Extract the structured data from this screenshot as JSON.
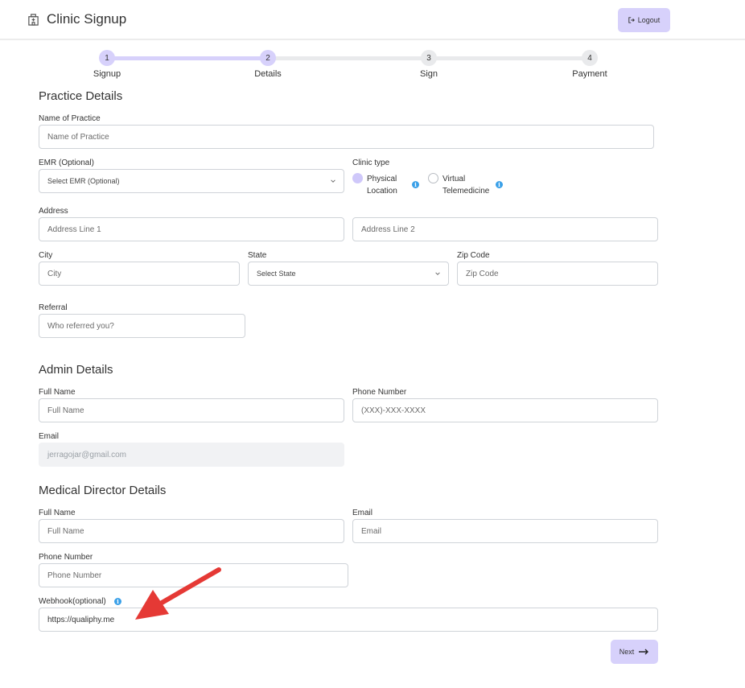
{
  "header": {
    "title": "Clinic Signup",
    "logout_label": "Logout",
    "logout_icon": "logout-icon",
    "brand_icon": "hospital-icon"
  },
  "stepper": {
    "current": 2,
    "steps": [
      {
        "number": "1",
        "label": "Signup"
      },
      {
        "number": "2",
        "label": "Details"
      },
      {
        "number": "3",
        "label": "Sign"
      },
      {
        "number": "4",
        "label": "Payment"
      }
    ],
    "active_color": "#d7d1fb",
    "inactive_color": "#e9eaec"
  },
  "practice": {
    "title": "Practice Details",
    "name_label": "Name of Practice",
    "name_placeholder": "Name of Practice",
    "emr_label": "EMR (Optional)",
    "emr_selected": "Select EMR (Optional)",
    "clinic_type_label": "Clinic type",
    "clinic_type_options": [
      {
        "line1": "Physical",
        "line2": "Location",
        "selected": true
      },
      {
        "line1": "Virtual",
        "line2": "Telemedicine",
        "selected": false
      }
    ],
    "address_label": "Address",
    "address1_placeholder": "Address Line 1",
    "address2_placeholder": "Address Line 2",
    "city_label": "City",
    "city_placeholder": "City",
    "state_label": "State",
    "state_selected": "Select State",
    "zip_label": "Zip Code",
    "zip_placeholder": "Zip Code",
    "referral_label": "Referral",
    "referral_placeholder": "Who referred you?"
  },
  "admin": {
    "title": "Admin Details",
    "fullname_label": "Full Name",
    "fullname_placeholder": "Full Name",
    "phone_label": "Phone Number",
    "phone_placeholder": "(XXX)-XXX-XXXX",
    "email_label": "Email",
    "email_value": "jerragojar@gmail.com"
  },
  "director": {
    "title": "Medical Director Details",
    "fullname_label": "Full Name",
    "fullname_placeholder": "Full Name",
    "email_label": "Email",
    "email_placeholder": "Email",
    "phone_label": "Phone Number",
    "phone_placeholder": "Phone Number",
    "webhook_label": "Webhook(optional)",
    "webhook_value": "https://qualiphy.me"
  },
  "next_label": "Next",
  "accent_color": "#d7d1fb",
  "annotation_color": "#e53935"
}
